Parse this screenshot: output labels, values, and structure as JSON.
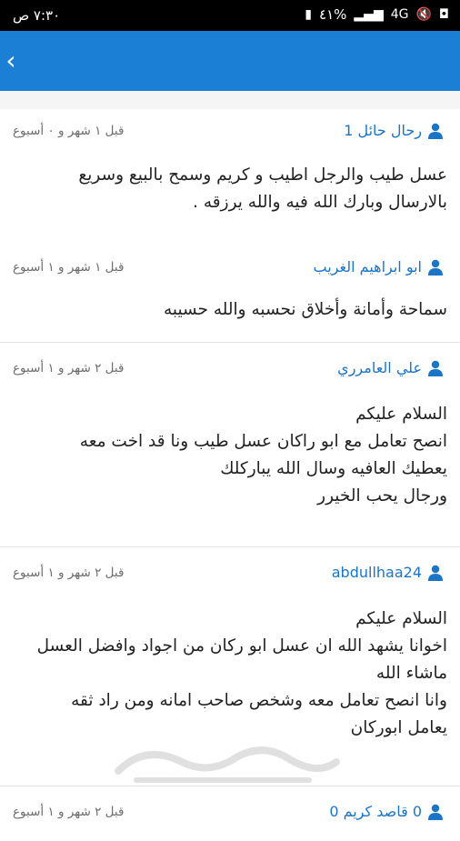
{
  "status_bar": {
    "time": "٧:٣٠ ص",
    "battery": "٤١%",
    "network": "4G"
  },
  "app_bar": {
    "back_icon": "chevron-left-icon"
  },
  "comments": [
    {
      "author": "رحال حائل 1",
      "time": "قبل ١ شهر و ٠ أسبوع",
      "lines": [
        "عسل طيب والرجل اطيب و كريم وسمح بالبيع وسريع",
        "بالارسال وبارك الله فيه والله يرزقه ."
      ]
    },
    {
      "author": "ابو ابراهيم الغريب",
      "time": "قبل ١ شهر و ١ أسبوع",
      "lines": [
        "سماحة وأمانة وأخلاق نحسبه والله حسيبه"
      ]
    },
    {
      "author": "علي العامرري",
      "time": "قبل ٢ شهر و ١ أسبوع",
      "lines": [
        "السلام عليكم",
        "انصح تعامل مع ابو راكان عسل طيب ونا قد اخت معه",
        "يعطيك العافيه  وسال الله يباركلك",
        "ورجال يحب الخيرر"
      ]
    },
    {
      "author": "abdullhaa24",
      "time": "قبل ٢ شهر و ١ أسبوع",
      "lines": [
        "السلام عليكم",
        "اخوانا يشهد الله ان عسل ابو ركان من اجواد وافضل العسل",
        "ماشاء الله",
        "وانا انصح  تعامل معه وشخص صاحب امانه ومن راد ثقه",
        "يعامل ابوركان"
      ]
    },
    {
      "author": "0 قاصد كريم 0",
      "time": "قبل ٢ شهر و ١ أسبوع",
      "lines": []
    }
  ],
  "watermark": "حراج"
}
